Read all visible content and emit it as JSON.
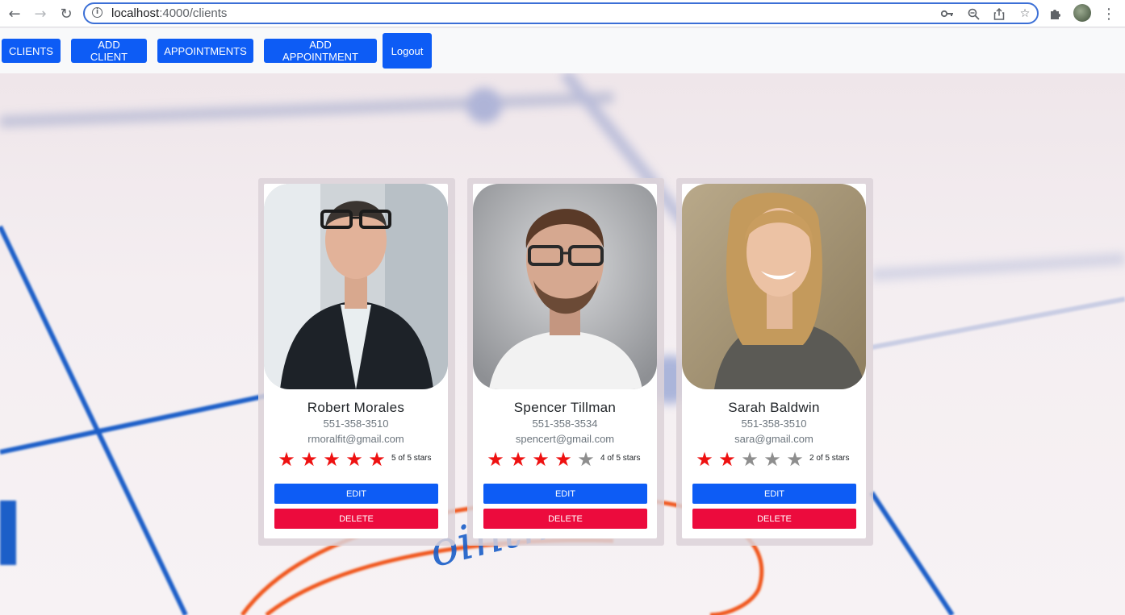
{
  "browser": {
    "url_host": "localhost",
    "url_path": ":4000/clients"
  },
  "navbar": {
    "clients_label": "CLIENTS",
    "add_client_label": "ADD CLIENT",
    "appointments_label": "APPOINTMENTS",
    "add_appointment_label": "ADD APPOINTMENT",
    "logout_label": "Logout"
  },
  "clients": [
    {
      "name": "Robert Morales",
      "phone": "551-358-3510",
      "email": "rmoralfit@gmail.com",
      "rating": 5,
      "rating_text": "5 of 5 stars",
      "edit_label": "EDIT",
      "delete_label": "DELETE"
    },
    {
      "name": "Spencer Tillman",
      "phone": "551-358-3534",
      "email": "spencert@gmail.com",
      "rating": 4,
      "rating_text": "4 of 5 stars",
      "edit_label": "EDIT",
      "delete_label": "DELETE"
    },
    {
      "name": "Sarah Baldwin",
      "phone": "551-358-3510",
      "email": "sara@gmail.com",
      "rating": 2,
      "rating_text": "2 of 5 stars",
      "edit_label": "EDIT",
      "delete_label": "DELETE"
    }
  ],
  "background_text": "ointment!",
  "colors": {
    "primary": "#0d5cf5",
    "danger": "#ec0b3d",
    "star_on": "#ee1111",
    "star_off": "#8e8e8e"
  }
}
